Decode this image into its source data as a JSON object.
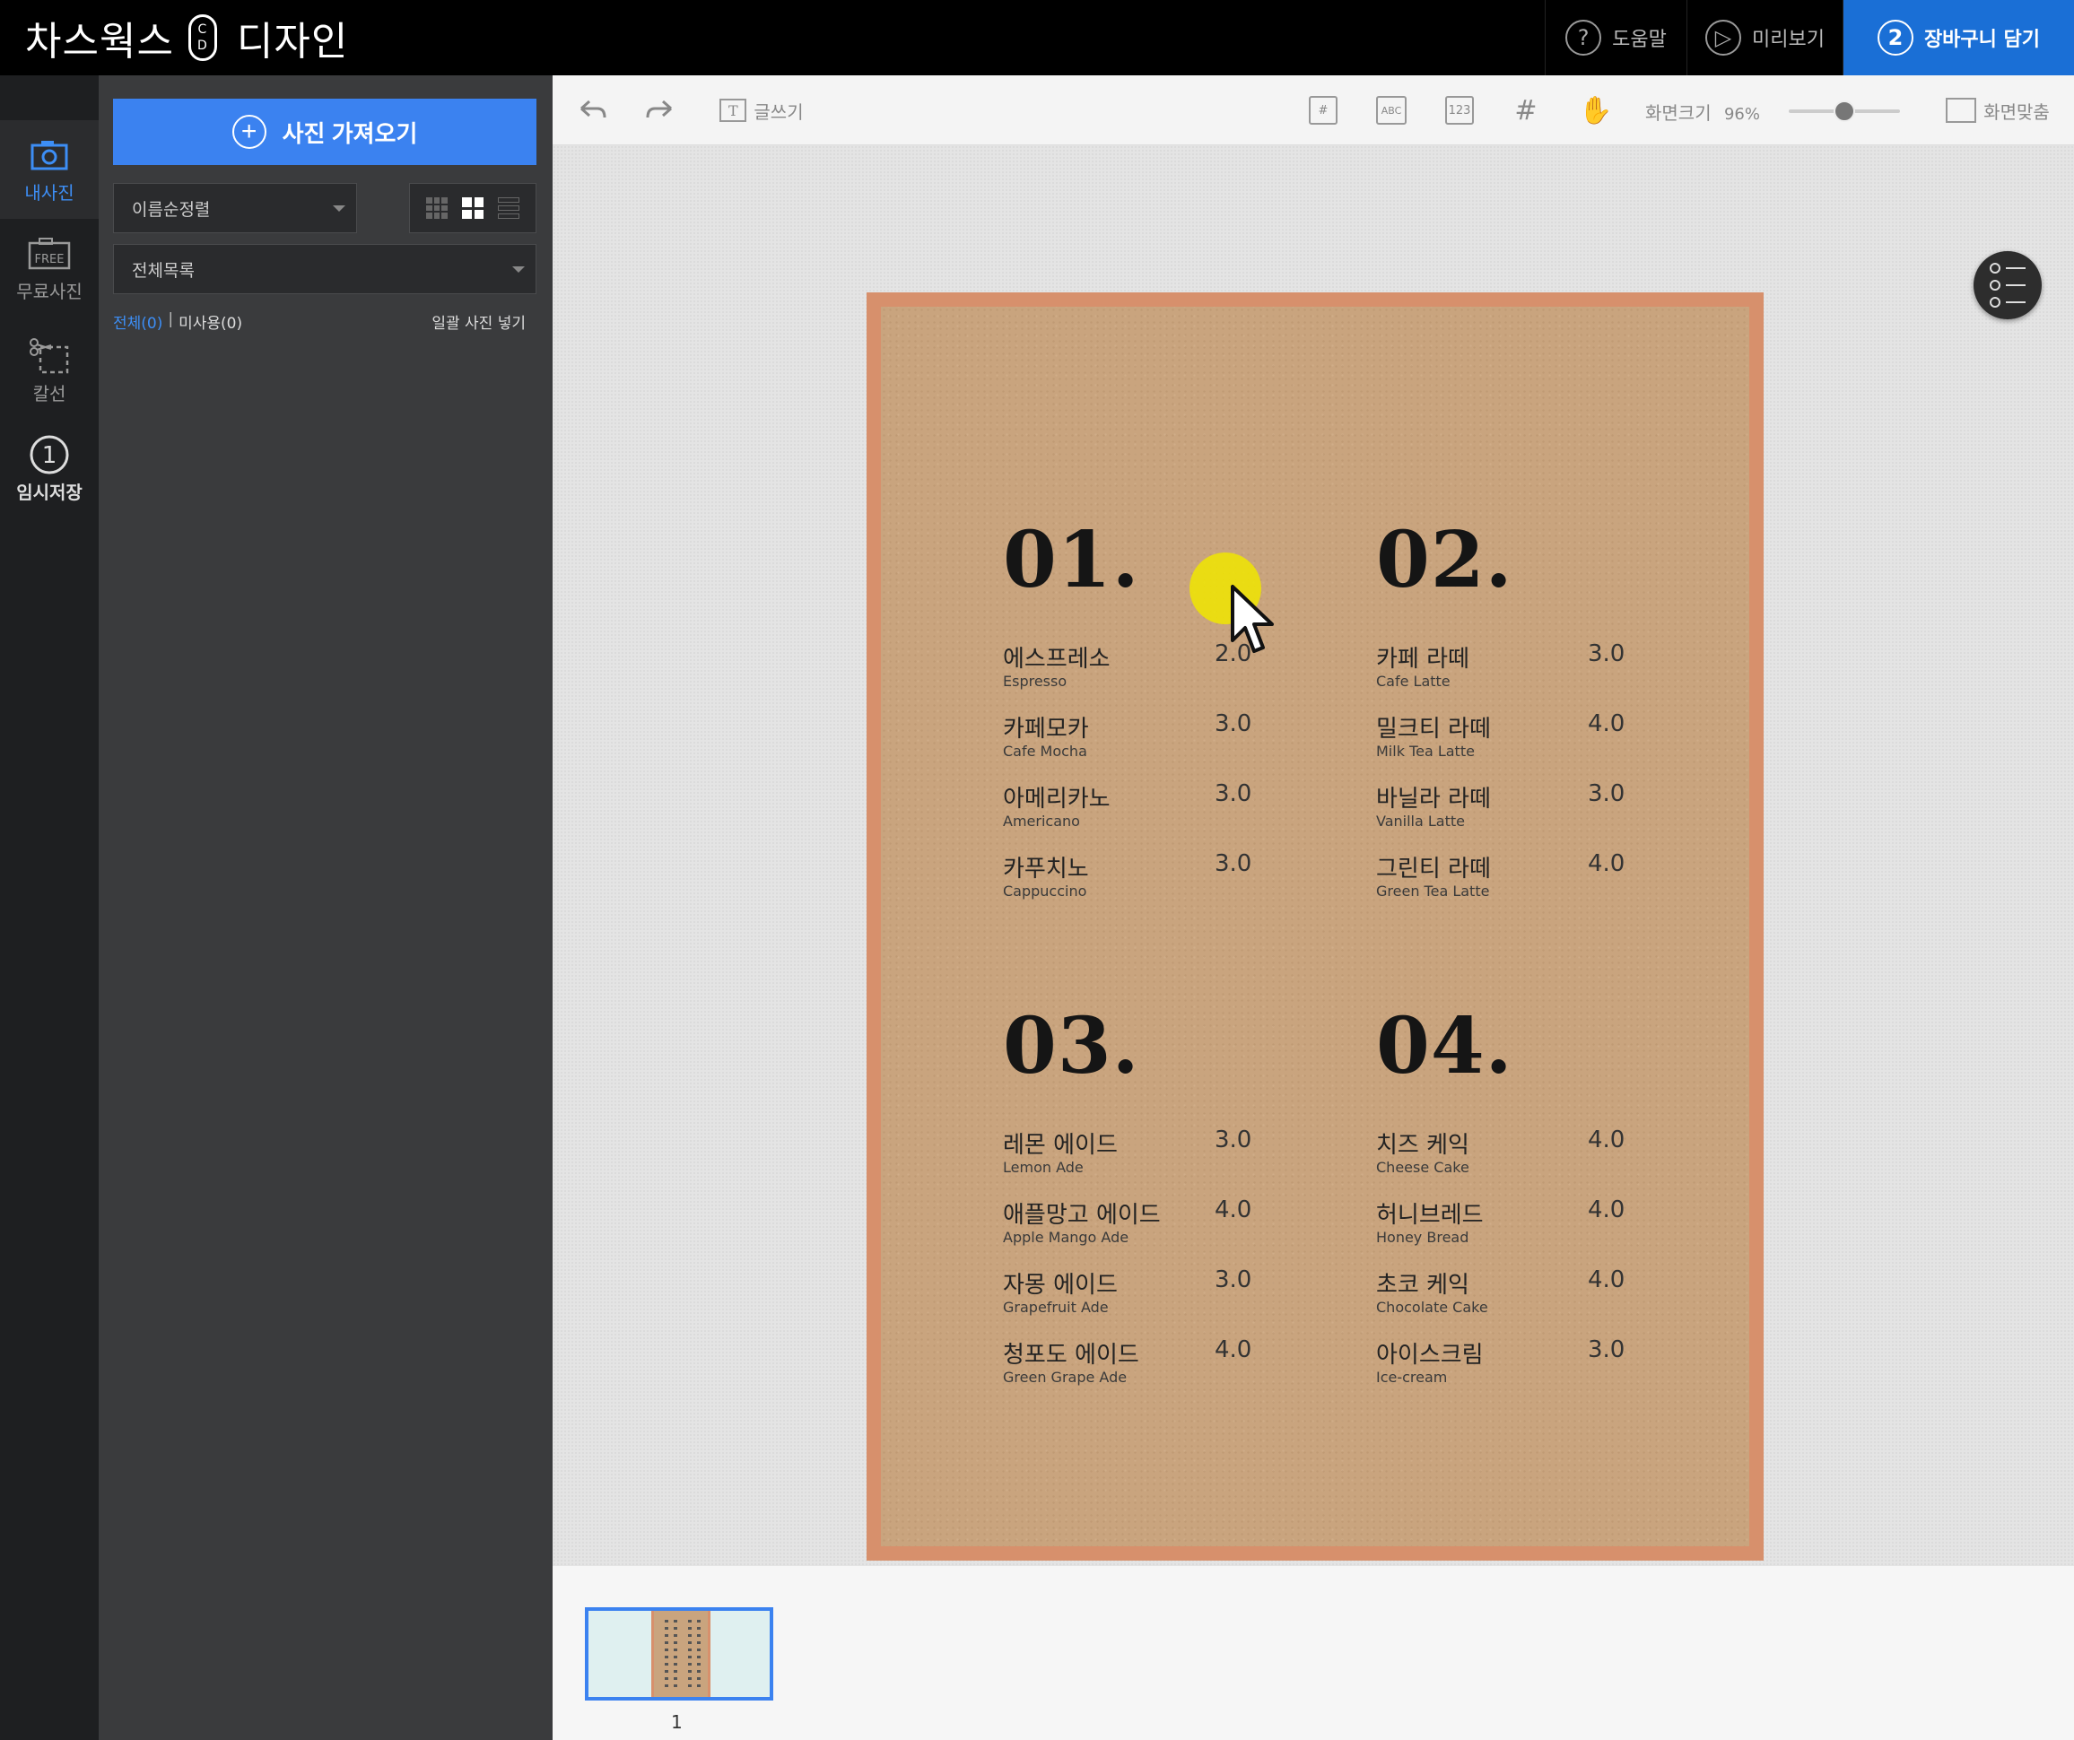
{
  "app": {
    "brand_left": "차스웍스",
    "brand_pill_top": "C",
    "brand_pill_bottom": "D",
    "brand_right": "디자인"
  },
  "topbar": {
    "help_label": "도움말",
    "preview_label": "미리보기",
    "cart_step": "2",
    "cart_label": "장바구니 담기",
    "accent_color": "#1a6fd6"
  },
  "rail": {
    "my_photos": "내사진",
    "free_photos": "무료사진",
    "free_badge": "FREE",
    "cut_line": "칼선",
    "temp_step": "1",
    "temp_save": "임시저장"
  },
  "panel": {
    "import_label": "사진 가져오기",
    "sort_value": "이름순정렬",
    "list_value": "전체목록",
    "filter_all": "전체(0)",
    "filter_unused": "미사용(0)",
    "bulk_insert": "일괄 사진 넣기"
  },
  "toolbar": {
    "write_label": "글쓰기",
    "abc_label": "ABC",
    "num_label": "123",
    "zoom_label": "화면크기",
    "zoom_value": "96%",
    "zoom_level": 0.5,
    "fit_label": "화면맞춤"
  },
  "menu": {
    "sections": [
      {
        "num": "01.",
        "items": [
          {
            "ko": "에스프레소",
            "en": "Espresso",
            "price": "2.0"
          },
          {
            "ko": "카페모카",
            "en": "Cafe Mocha",
            "price": "3.0"
          },
          {
            "ko": "아메리카노",
            "en": "Americano",
            "price": "3.0"
          },
          {
            "ko": "카푸치노",
            "en": "Cappuccino",
            "price": "3.0"
          }
        ]
      },
      {
        "num": "02.",
        "items": [
          {
            "ko": "카페 라떼",
            "en": "Cafe Latte",
            "price": "3.0"
          },
          {
            "ko": "밀크티 라떼",
            "en": "Milk Tea Latte",
            "price": "4.0"
          },
          {
            "ko": "바닐라 라떼",
            "en": "Vanilla Latte",
            "price": "3.0"
          },
          {
            "ko": "그린티 라떼",
            "en": "Green Tea Latte",
            "price": "4.0"
          }
        ]
      },
      {
        "num": "03.",
        "items": [
          {
            "ko": "레몬 에이드",
            "en": "Lemon Ade",
            "price": "3.0"
          },
          {
            "ko": "애플망고 에이드",
            "en": "Apple Mango Ade",
            "price": "4.0"
          },
          {
            "ko": "자몽 에이드",
            "en": "Grapefruit Ade",
            "price": "3.0"
          },
          {
            "ko": "청포도 에이드",
            "en": "Green Grape Ade",
            "price": "4.0"
          }
        ]
      },
      {
        "num": "04.",
        "items": [
          {
            "ko": "치즈 케익",
            "en": "Cheese Cake",
            "price": "4.0"
          },
          {
            "ko": "허니브레드",
            "en": "Honey Bread",
            "price": "4.0"
          },
          {
            "ko": "초코 케익",
            "en": "Chocolate Cake",
            "price": "4.0"
          },
          {
            "ko": "아이스크림",
            "en": "Ice-cream",
            "price": "3.0"
          }
        ]
      }
    ]
  },
  "pages": {
    "thumb_label": "1"
  }
}
